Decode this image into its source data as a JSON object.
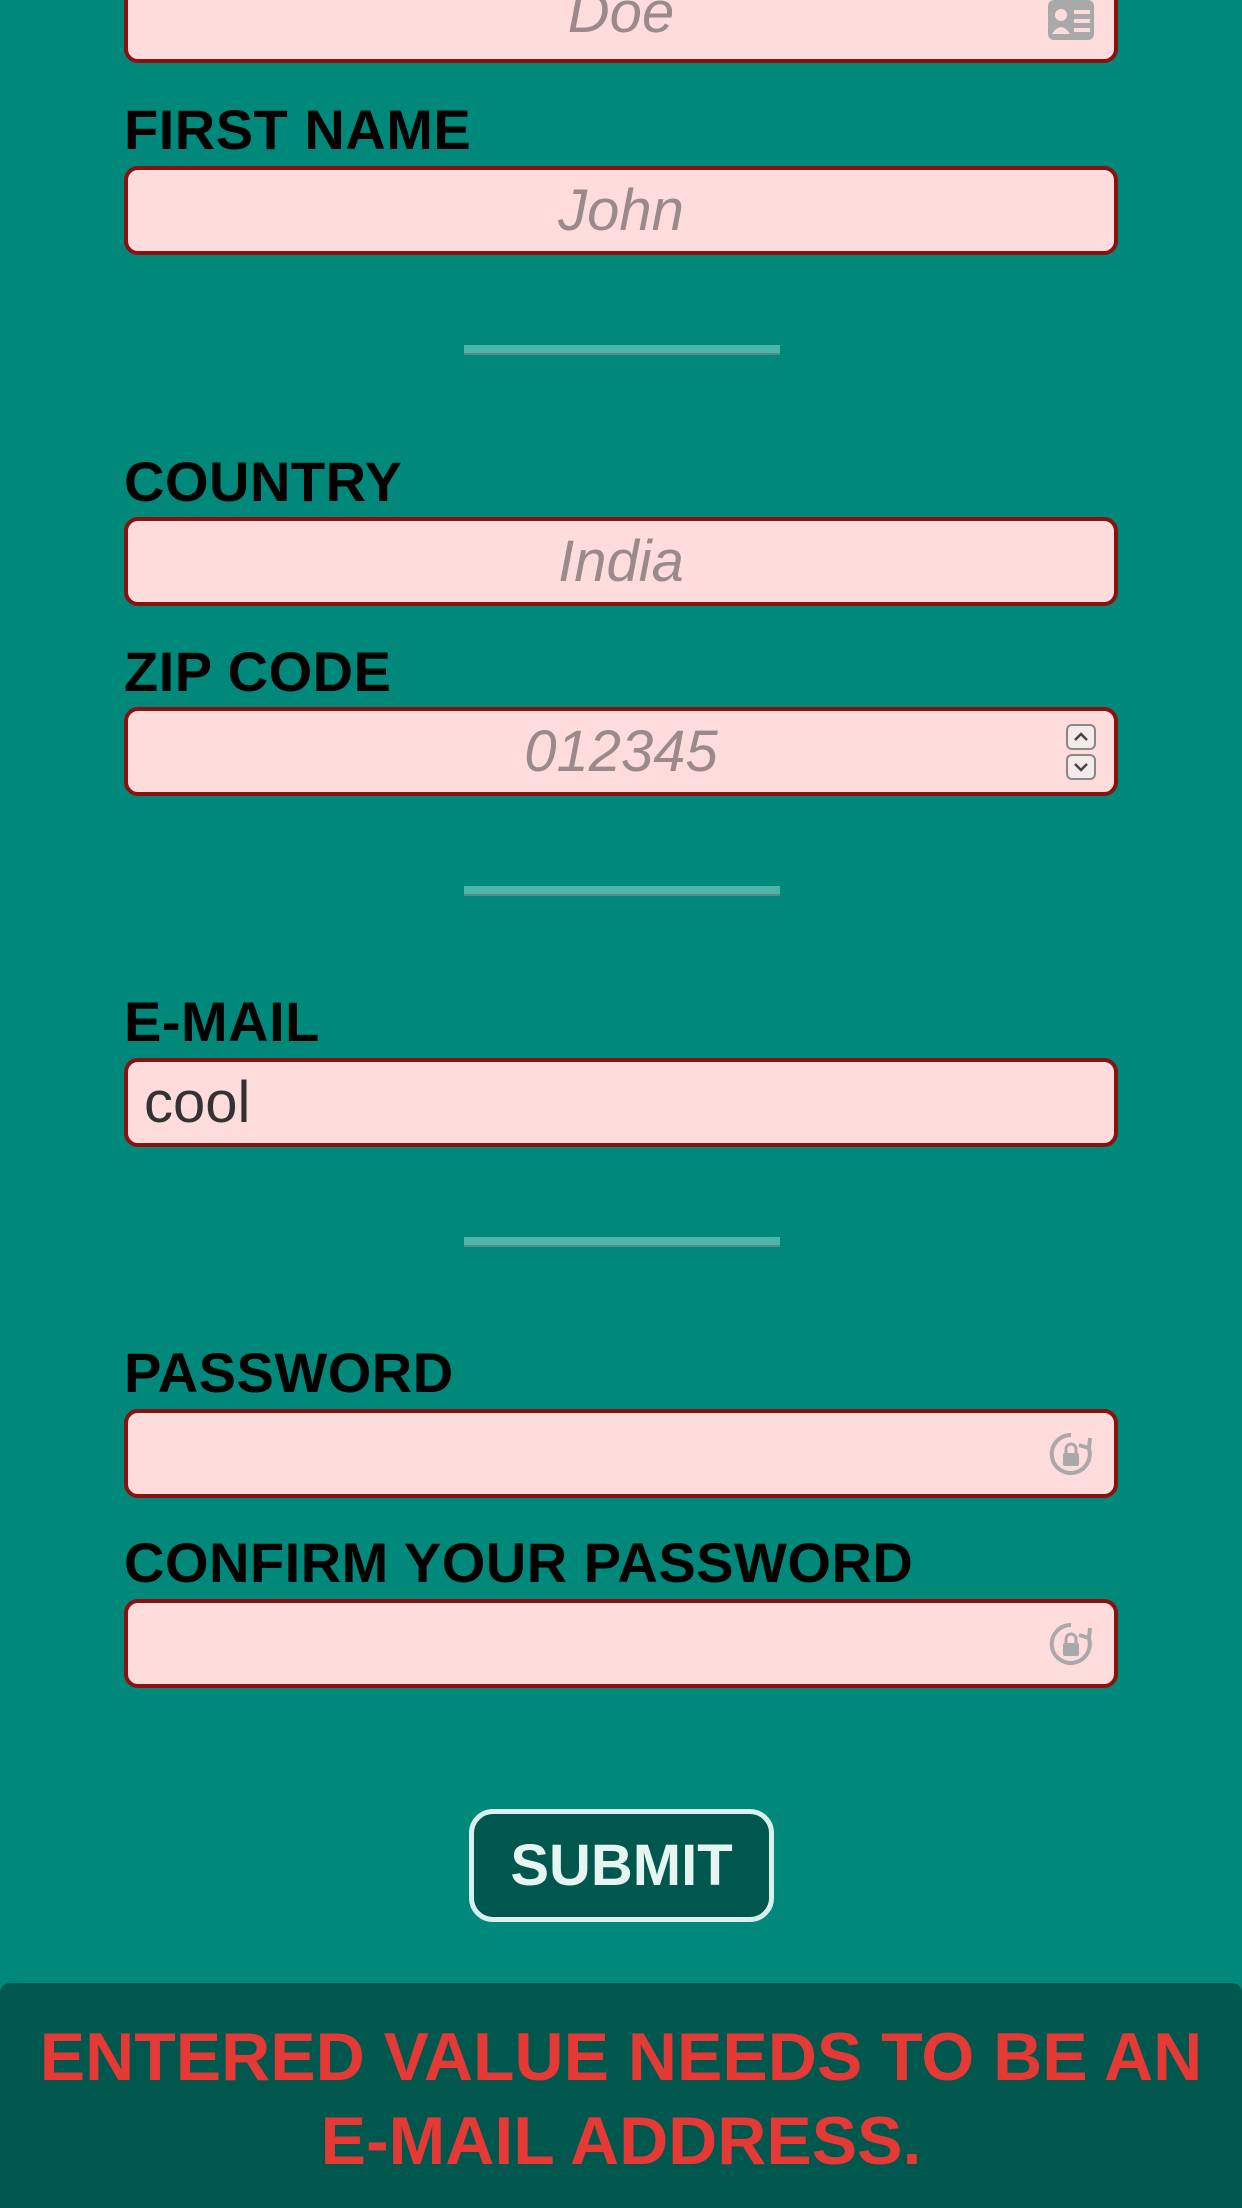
{
  "form": {
    "last_name": {
      "placeholder": "Doe",
      "icon": "contact-card-icon"
    },
    "first_name": {
      "label": "FIRST NAME",
      "placeholder": "John"
    },
    "country": {
      "label": "COUNTRY",
      "placeholder": "India"
    },
    "zip": {
      "label": "ZIP CODE",
      "placeholder": "012345",
      "icon": "number-stepper-icon"
    },
    "email": {
      "label": "E-MAIL",
      "value": "cool"
    },
    "password": {
      "label": "PASSWORD",
      "value": "",
      "icon": "password-key-icon"
    },
    "confirm_password": {
      "label": "CONFIRM YOUR PASSWORD",
      "value": "",
      "icon": "password-key-icon"
    },
    "submit_label": "SUBMIT"
  },
  "error": {
    "message": "ENTERED VALUE NEEDS TO BE AN E-MAIL ADDRESS."
  },
  "colors": {
    "background": "#00897b",
    "field_fill": "#ffdcdc",
    "field_border": "#8b1010",
    "error_text": "#e53935",
    "banner": "#00574e"
  }
}
